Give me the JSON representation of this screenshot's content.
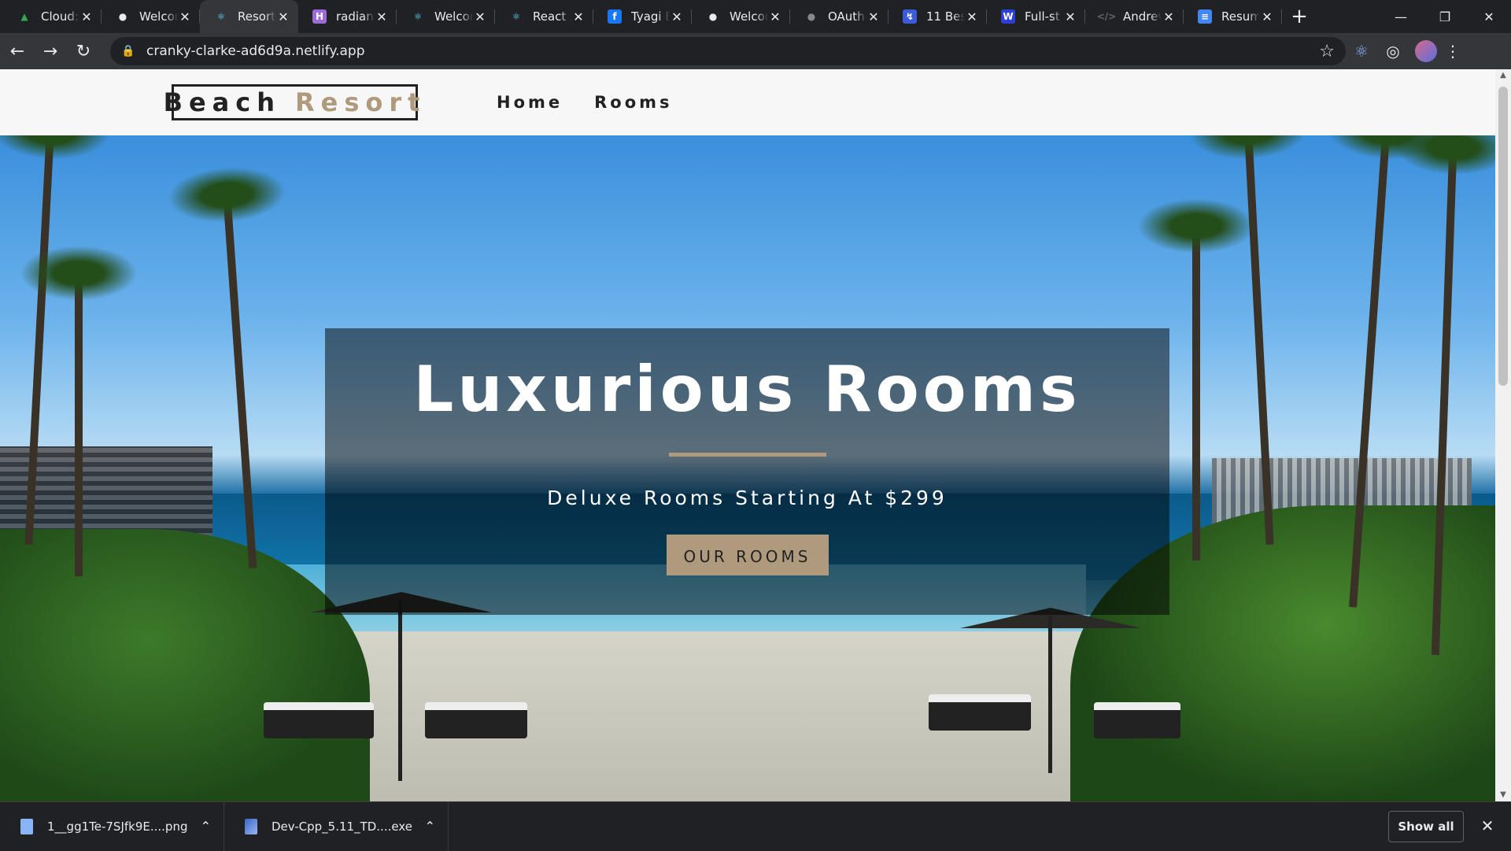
{
  "browser": {
    "tabs": [
      {
        "title": "Cloud:",
        "favicon": "leaf-icon",
        "color": "#34a853"
      },
      {
        "title": "Welcor",
        "favicon": "globe-icon",
        "color": "#e8eaed"
      },
      {
        "title": "Resort",
        "favicon": "react-icon",
        "color": "#61dafb",
        "active": true
      },
      {
        "title": "radiant",
        "favicon": "h-icon",
        "color": "#9c6bd8"
      },
      {
        "title": "Welcor",
        "favicon": "react-icon",
        "color": "#61dafb"
      },
      {
        "title": "React /",
        "favicon": "react-icon",
        "color": "#61dafb"
      },
      {
        "title": "Tyagi E",
        "favicon": "facebook-icon",
        "color": "#1877f2"
      },
      {
        "title": "Welcor",
        "favicon": "globe-icon",
        "color": "#e8eaed"
      },
      {
        "title": "OAuth",
        "favicon": "github-icon",
        "color": "#888888"
      },
      {
        "title": "11 Bes",
        "favicon": "bolt-icon",
        "color": "#3b5bdb"
      },
      {
        "title": "Full-st",
        "favicon": "w-icon",
        "color": "#2c3fd6"
      },
      {
        "title": "Andrev",
        "favicon": "code-icon",
        "color": "#666666"
      },
      {
        "title": "Resum",
        "favicon": "docs-icon",
        "color": "#4285f4"
      }
    ],
    "url": "cranky-clarke-ad6d9a.netlify.app"
  },
  "site": {
    "logo_part1": "Beach",
    "logo_part2": "Resort",
    "nav": {
      "home": "Home",
      "rooms": "Rooms"
    },
    "accent_color": "#af9a7d"
  },
  "hero": {
    "title": "Luxurious Rooms",
    "subtitle": "Deluxe Rooms Starting At $299",
    "button": "our rooms"
  },
  "downloads": {
    "items": [
      {
        "name": "1__gg1Te-7SJfk9E....png"
      },
      {
        "name": "Dev-Cpp_5.11_TD....exe"
      }
    ],
    "show_all": "Show all"
  }
}
